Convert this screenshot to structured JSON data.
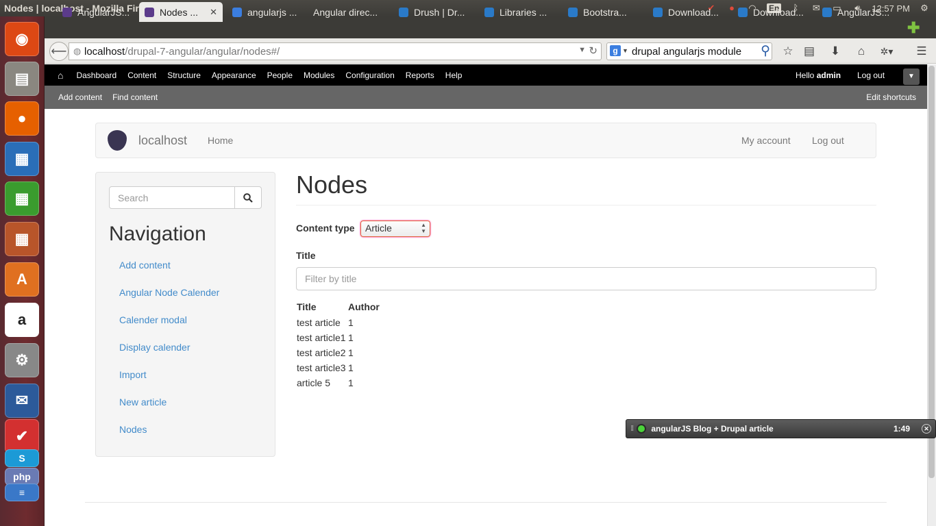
{
  "window": {
    "title": "Nodes | localhost - Mozilla Firefox"
  },
  "tray": {
    "lang": "En",
    "time": "12:57 PM"
  },
  "launcher": {
    "items": [
      {
        "name": "ubuntu-icon",
        "glyph": "◉",
        "color": "#dd4814"
      },
      {
        "name": "files-icon",
        "glyph": "▤",
        "color": "#8a8780"
      },
      {
        "name": "firefox-icon",
        "glyph": "●",
        "color": "#e66000"
      },
      {
        "name": "writer-icon",
        "glyph": "▦",
        "color": "#2a6eb8"
      },
      {
        "name": "calc-icon",
        "glyph": "▦",
        "color": "#3a9c2e"
      },
      {
        "name": "impress-icon",
        "glyph": "▦",
        "color": "#b8552a"
      },
      {
        "name": "software-center-icon",
        "glyph": "A",
        "color": "#e07020"
      },
      {
        "name": "amazon-icon",
        "glyph": "a",
        "color": "#ffffff"
      },
      {
        "name": "settings-icon",
        "glyph": "⚙",
        "color": "#888888"
      },
      {
        "name": "thunderbird-icon",
        "glyph": "✉",
        "color": "#2c5a9a"
      },
      {
        "name": "clock-icon",
        "glyph": "✔",
        "color": "#d33030"
      },
      {
        "name": "skype-icon",
        "glyph": "S",
        "color": "#1c9ad6"
      },
      {
        "name": "php-icon",
        "glyph": "php",
        "color": "#6a7bb4"
      },
      {
        "name": "stack-icon",
        "glyph": "≡",
        "color": "#3a78c8"
      }
    ]
  },
  "tabs": [
    {
      "label": "AngularJS...",
      "fav": "#5b3b8a",
      "active": false
    },
    {
      "label": "Nodes ...",
      "fav": "#5b3b8a",
      "active": true
    },
    {
      "label": "angularjs ...",
      "fav": "#3b7ee0",
      "active": false
    },
    {
      "label": "Angular direc...",
      "fav": "",
      "active": false
    },
    {
      "label": "Drush | Dr...",
      "fav": "#2a7ac8",
      "active": false
    },
    {
      "label": "Libraries ...",
      "fav": "#2a7ac8",
      "active": false
    },
    {
      "label": "Bootstra...",
      "fav": "#2a7ac8",
      "active": false
    },
    {
      "label": "Download...",
      "fav": "#2a7ac8",
      "active": false
    },
    {
      "label": "Download...",
      "fav": "#2a7ac8",
      "active": false
    },
    {
      "label": "AngularJS...",
      "fav": "#2a7ac8",
      "active": false
    }
  ],
  "url": {
    "host": "localhost",
    "path": "/drupal-7-angular/angular/nodes#/"
  },
  "search": {
    "value": "drupal angularjs module"
  },
  "admin": {
    "menu": [
      "Dashboard",
      "Content",
      "Structure",
      "Appearance",
      "People",
      "Modules",
      "Configuration",
      "Reports",
      "Help"
    ],
    "hello": "Hello ",
    "user": "admin",
    "logout": "Log out"
  },
  "shortcuts": {
    "items": [
      "Add content",
      "Find content"
    ],
    "edit": "Edit shortcuts"
  },
  "site": {
    "name": "localhost",
    "home": "Home",
    "account": "My account",
    "logout": "Log out"
  },
  "sidebar": {
    "search_placeholder": "Search",
    "heading": "Navigation",
    "items": [
      "Add content",
      "Angular Node Calender",
      "Calender modal",
      "Display calender",
      "Import",
      "New article",
      "Nodes"
    ]
  },
  "main": {
    "title": "Nodes",
    "content_type_label": "Content type",
    "content_type_value": "Article",
    "title_label": "Title",
    "title_placeholder": "Filter by title",
    "table": {
      "headers": [
        "Title",
        "Author"
      ],
      "rows": [
        [
          "test article",
          "1"
        ],
        [
          "test article1",
          "1"
        ],
        [
          "test article2",
          "1"
        ],
        [
          "test article3",
          "1"
        ],
        [
          "article 5",
          "1"
        ]
      ]
    }
  },
  "player": {
    "title": "angularJS Blog + Drupal article",
    "time": "1:49"
  }
}
